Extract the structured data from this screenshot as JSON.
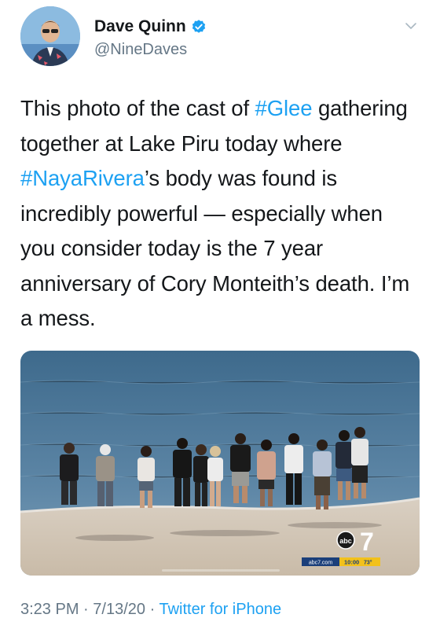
{
  "author": {
    "display_name": "Dave Quinn",
    "handle": "@NineDaves",
    "verified": true,
    "avatar_icon": "user-avatar-photo"
  },
  "tweet": {
    "segments": [
      {
        "text": "This photo of the cast of ",
        "type": "text"
      },
      {
        "text": "#Glee",
        "type": "hashtag"
      },
      {
        "text": " gathering together at Lake Piru today where ",
        "type": "text"
      },
      {
        "text": "#NayaRivera",
        "type": "hashtag"
      },
      {
        "text": "’s body was found is incredibly powerful — especially when you consider today is the 7 year anniversary of Cory Monteith’s death. I’m a mess.",
        "type": "text"
      }
    ]
  },
  "media": {
    "watermark": {
      "channel_logo": "abc",
      "channel_number": "7",
      "site": "abc7.com",
      "time": "10:00",
      "temp": "73°"
    }
  },
  "meta": {
    "time": "3:23 PM",
    "separator": "·",
    "date": "7/13/20",
    "source": "Twitter for iPhone"
  },
  "colors": {
    "link": "#1da1f2",
    "secondary_text": "#657786",
    "primary_text": "#14171a"
  }
}
